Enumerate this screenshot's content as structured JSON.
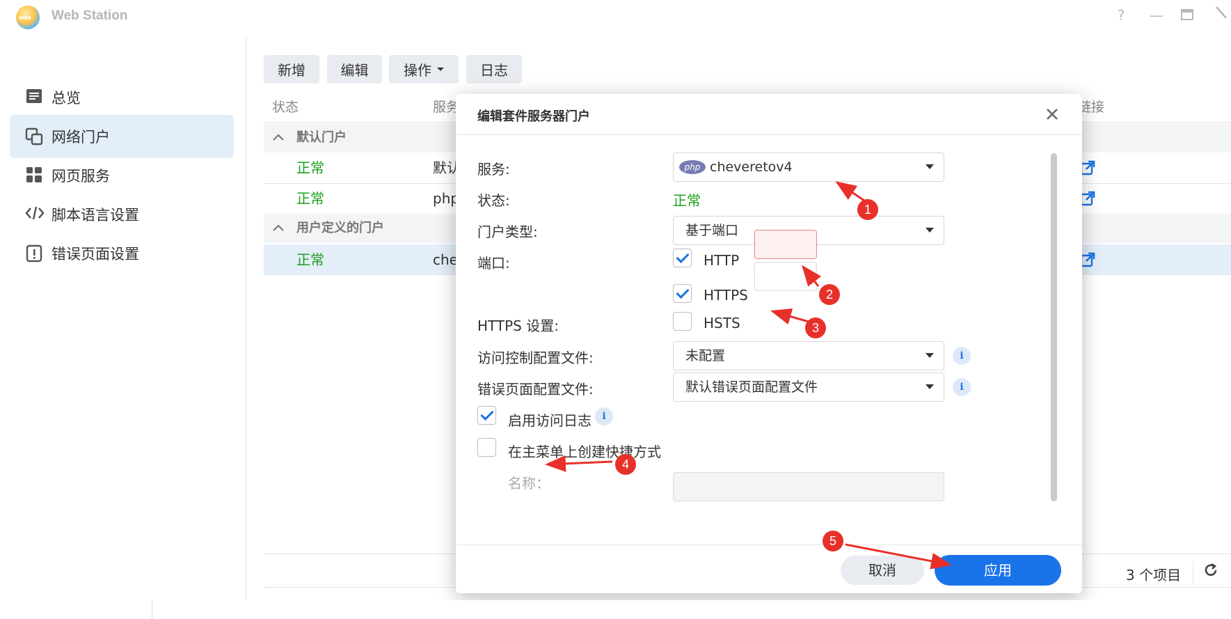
{
  "window": {
    "title": "Web Station",
    "logo_text": "WEB",
    "controls": {
      "help": "?",
      "minimize": "—",
      "maximize": "▭",
      "close": "⟋"
    }
  },
  "sidebar": {
    "items": [
      {
        "label": "总览",
        "icon": "overview-icon",
        "active": false
      },
      {
        "label": "网络门户",
        "icon": "web-portal-icon",
        "active": true
      },
      {
        "label": "网页服务",
        "icon": "web-service-icon",
        "active": false
      },
      {
        "label": "脚本语言设置",
        "icon": "code-icon",
        "active": false
      },
      {
        "label": "错误页面设置",
        "icon": "error-page-icon",
        "active": false
      }
    ]
  },
  "toolbar": {
    "add": "新增",
    "edit": "编辑",
    "action": "操作",
    "log": "日志"
  },
  "table": {
    "columns": {
      "status": "状态",
      "service": "服务",
      "link": "链接"
    },
    "groups": [
      {
        "label": "默认门户",
        "rows": [
          {
            "status": "正常",
            "service": "默认"
          },
          {
            "status": "正常",
            "service": "php"
          }
        ]
      },
      {
        "label": "用户定义的门户",
        "rows": [
          {
            "status": "正常",
            "service": "che"
          }
        ]
      }
    ],
    "footer_count": "3 个项目"
  },
  "modal": {
    "title": "编辑套件服务器门户",
    "fields": {
      "service_label": "服务:",
      "service_value": "cheveretov4",
      "service_badge": "php",
      "status_label": "状态:",
      "status_value": "正常",
      "portal_type_label": "门户类型:",
      "portal_type_value": "基于端口",
      "port_label": "端口:",
      "http_label": "HTTP",
      "https_label": "HTTPS",
      "https_settings_label": "HTTPS 设置:",
      "hsts_label": "HSTS",
      "access_control_label": "访问控制配置文件:",
      "access_control_value": "未配置",
      "error_page_label": "错误页面配置文件:",
      "error_page_value": "默认错误页面配置文件",
      "enable_access_log_label": "启用访问日志",
      "create_shortcut_label": "在主菜单上创建快捷方式",
      "name_label": "名称："
    },
    "checkboxes": {
      "http": true,
      "https": true,
      "hsts": false,
      "access_log": true,
      "shortcut": false
    },
    "buttons": {
      "cancel": "取消",
      "apply": "应用"
    }
  },
  "annotations": [
    "1",
    "2",
    "3",
    "4",
    "5"
  ],
  "colors": {
    "accent": "#1a73e8",
    "status_ok": "#1aa01a",
    "annotation": "#e8302a",
    "selected_bg": "#e3eef9"
  }
}
